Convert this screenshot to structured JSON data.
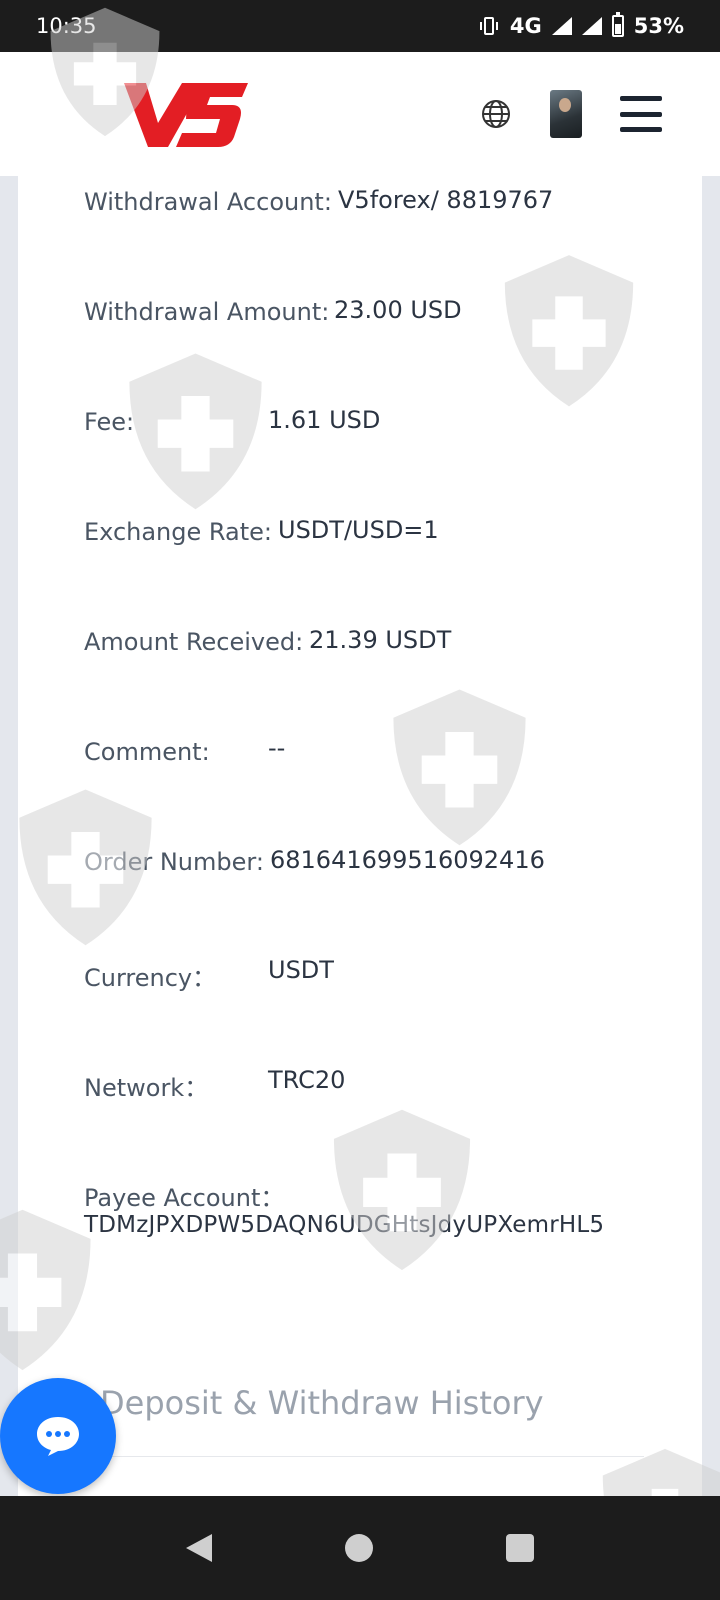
{
  "status_bar": {
    "time": "10:35",
    "network": "4G",
    "battery": "53%",
    "battery_level": 0.53
  },
  "header": {
    "logo_text": "V5"
  },
  "details": [
    {
      "label": "Withdrawal Account:",
      "value": "V5forex/ 8819767"
    },
    {
      "label": "Withdrawal Amount:",
      "value": "23.00 USD"
    },
    {
      "label": "Fee:",
      "value": "1.61 USD"
    },
    {
      "label": "Exchange Rate:",
      "value": "USDT/USD=1"
    },
    {
      "label": "Amount Received:",
      "value": "21.39 USDT"
    },
    {
      "label": "Comment:",
      "value": "--"
    },
    {
      "label": "Order Number:",
      "value": "681641699516092416"
    },
    {
      "label": "Currency：",
      "value": "USDT"
    },
    {
      "label": "Network：",
      "value": "TRC20"
    }
  ],
  "payee": {
    "label": "Payee Account：",
    "value": "TDMzJPXDPW5DAQN6UDGHtsJdyUPXemrHL5"
  },
  "history": {
    "title": "Deposit & Withdraw History"
  },
  "colors": {
    "brand_red": "#e31e24",
    "fab_blue": "#1677ff"
  }
}
